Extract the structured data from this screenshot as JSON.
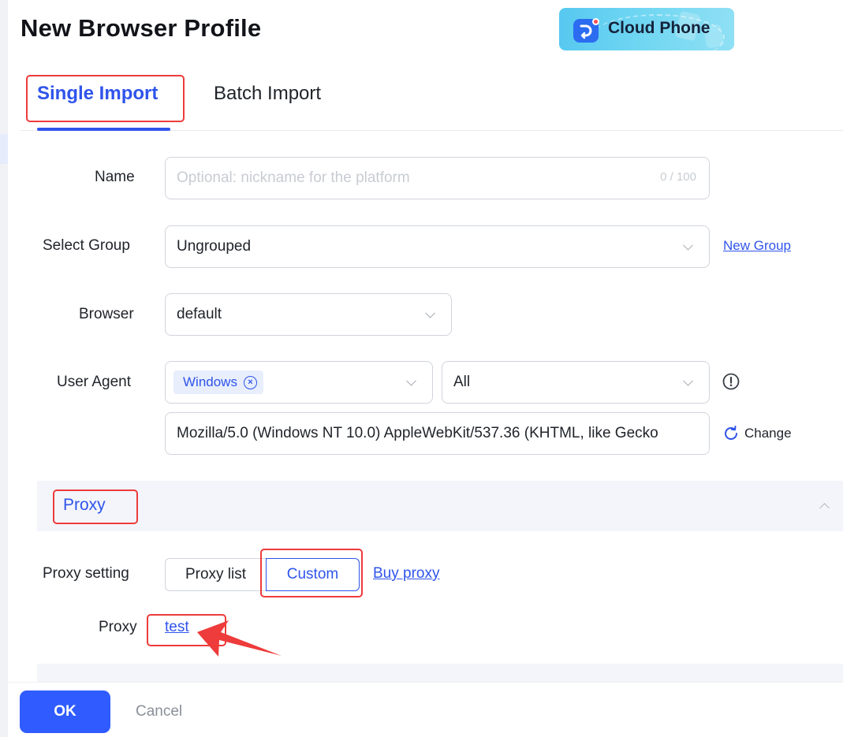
{
  "dialog": {
    "title": "New Browser Profile"
  },
  "banner": {
    "text": "Cloud Phone",
    "icon": "cloud-phone-logo-icon"
  },
  "tabs": [
    {
      "label": "Single Import",
      "active": true
    },
    {
      "label": "Batch Import",
      "active": false
    }
  ],
  "form": {
    "name": {
      "label": "Name",
      "placeholder": "Optional: nickname for the platform",
      "counter": "0 / 100"
    },
    "group": {
      "label": "Select Group",
      "value": "Ungrouped",
      "new_group_link": "New Group"
    },
    "browser": {
      "label": "Browser",
      "value": "default"
    },
    "user_agent": {
      "label": "User Agent",
      "os_tag": "Windows",
      "version": "All",
      "string": "Mozilla/5.0 (Windows NT 10.0) AppleWebKit/537.36 (KHTML, like Gecko",
      "change_label": "Change",
      "info_icon": "exclamation-circle-icon"
    }
  },
  "proxy": {
    "section_title": "Proxy",
    "setting_label": "Proxy setting",
    "options": [
      "Proxy list",
      "Custom"
    ],
    "selected": "Custom",
    "buy_link": "Buy proxy",
    "proxy_label": "Proxy",
    "proxy_value": "test"
  },
  "footer": {
    "ok": "OK",
    "cancel": "Cancel"
  },
  "colors": {
    "accent": "#2f54eb",
    "highlight": "#ee3b3b",
    "ok_button": "#2f5bff"
  }
}
